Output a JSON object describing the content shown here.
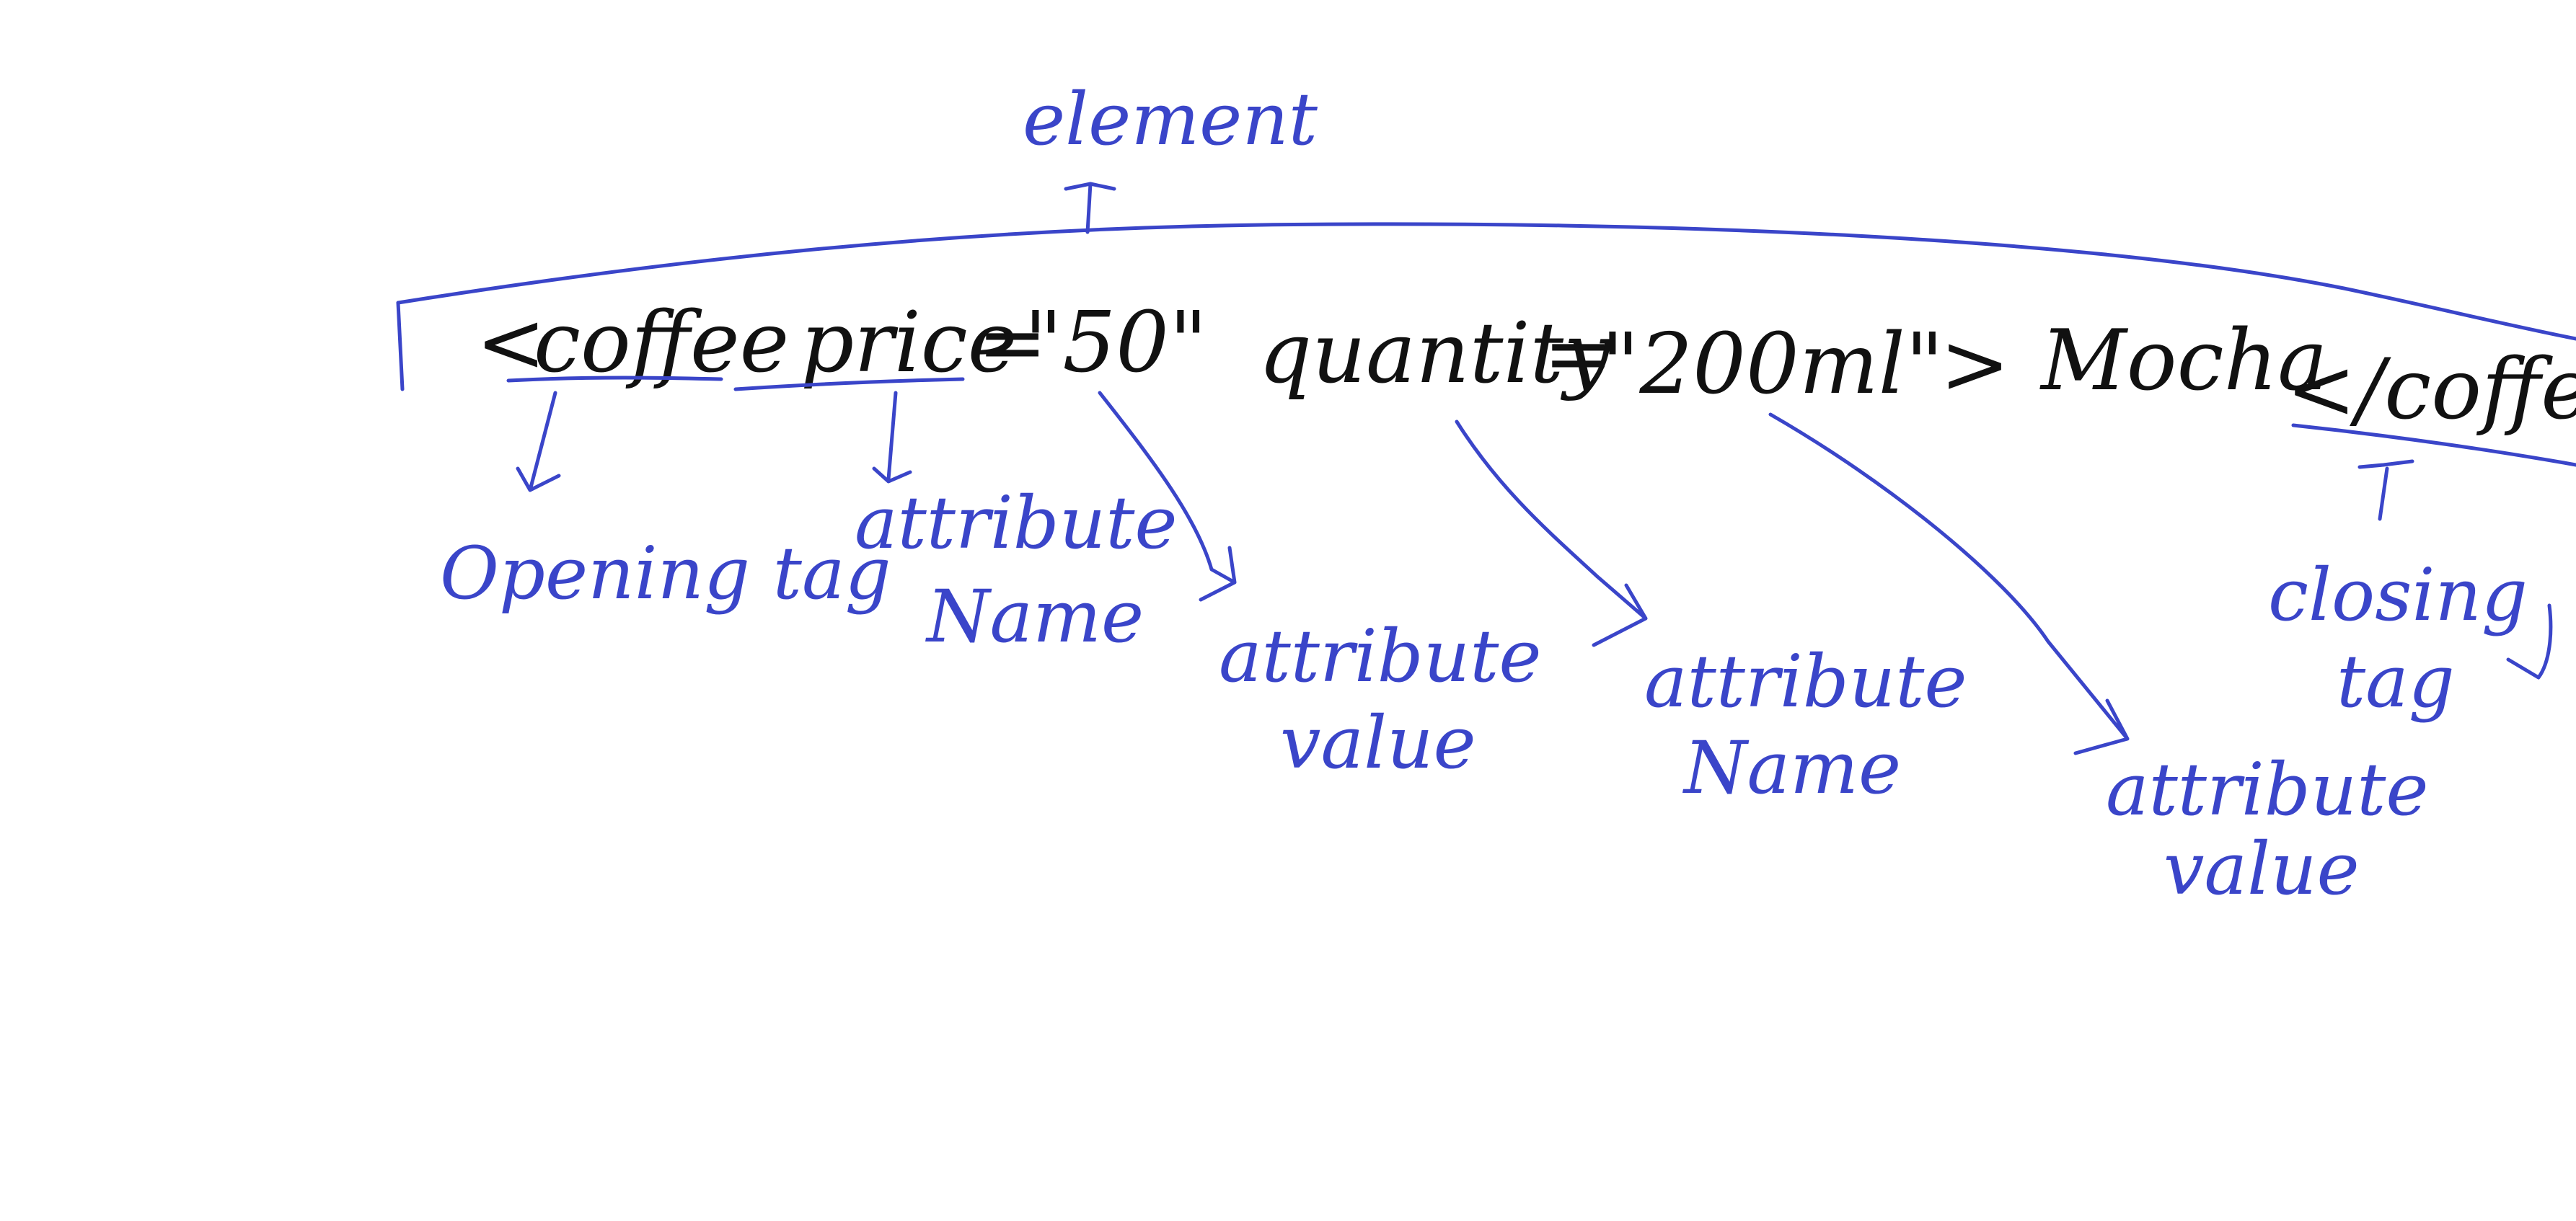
{
  "colors": {
    "annotation": "#3a45c9",
    "code": "#111111",
    "background": "#ffffff"
  },
  "code": {
    "open_bracket": "<",
    "tag_name": "coffee",
    "attr1_name": "price",
    "attr1_eq": "=",
    "attr1_value": "\"50\"",
    "attr2_name": "quantity",
    "attr2_eq": "=",
    "attr2_value": "\"200ml\"",
    "close_bracket": ">",
    "content": "Mocha",
    "closing_tag": "</coffee>"
  },
  "labels": {
    "element": "element",
    "opening_tag": "Opening tag",
    "attr1_name": [
      "attribute",
      "Name"
    ],
    "attr1_value": [
      "attribute",
      "value"
    ],
    "attr2_name": [
      "attribute",
      "Name"
    ],
    "attr2_value": [
      "attribute",
      "value"
    ],
    "closing_tag": [
      "closing",
      "tag"
    ]
  }
}
